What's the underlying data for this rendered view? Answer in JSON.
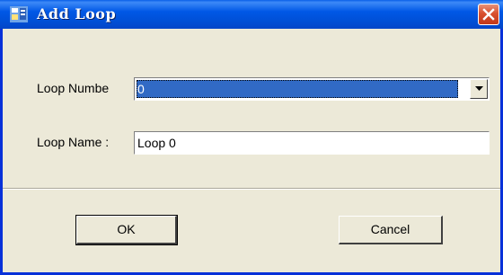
{
  "window": {
    "title": "Add Loop",
    "icon": "app-icon",
    "close_icon": "close-icon"
  },
  "form": {
    "loop_number_label": "Loop Numbe",
    "loop_number_value": "0",
    "loop_name_label": "Loop Name :",
    "loop_name_value": "Loop 0"
  },
  "buttons": {
    "ok_label": "OK",
    "cancel_label": "Cancel"
  },
  "colors": {
    "titlebar": "#0058e6",
    "window_face": "#ece9d8",
    "selection": "#316ac5",
    "close_button": "#d9502e"
  }
}
